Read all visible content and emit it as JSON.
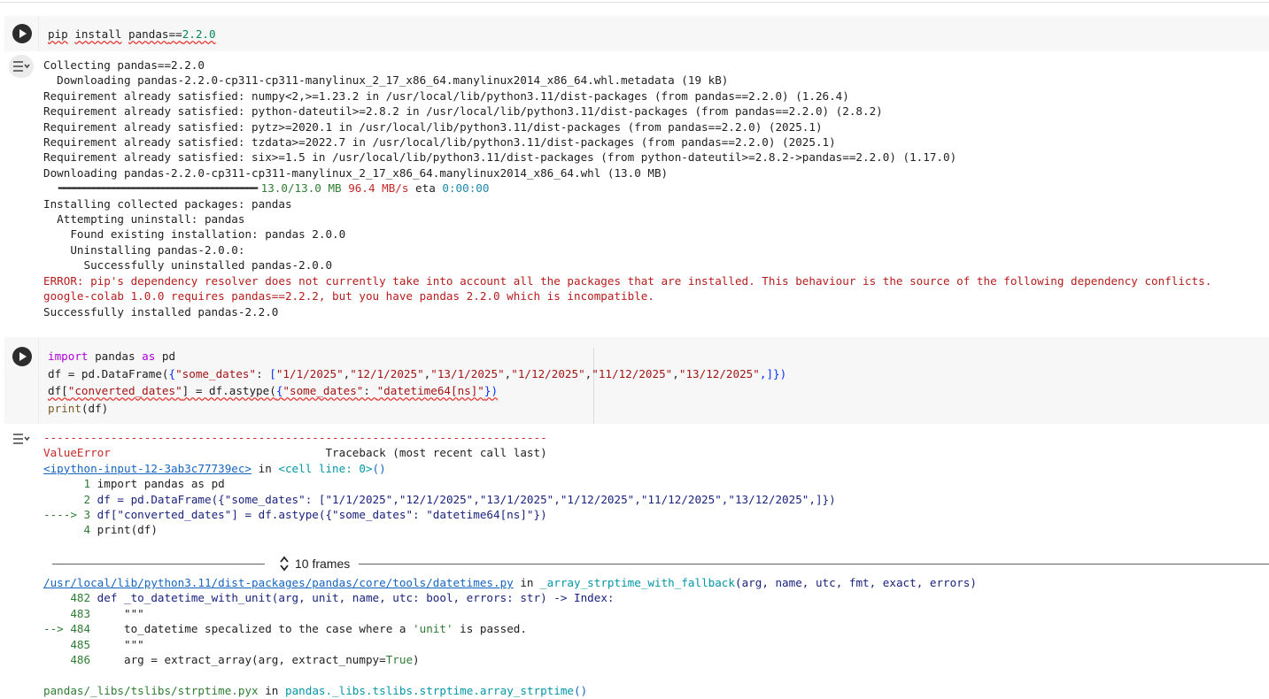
{
  "cell1": {
    "code": {
      "cmd": "pip",
      "install": "install",
      "pkg": "pandas",
      "eq": "==",
      "ver": "2.2.0"
    },
    "output": {
      "l1": "Collecting pandas==2.2.0",
      "l2": "  Downloading pandas-2.2.0-cp311-cp311-manylinux_2_17_x86_64.manylinux2014_x86_64.whl.metadata (19 kB)",
      "l3": "Requirement already satisfied: numpy<2,>=1.23.2 in /usr/local/lib/python3.11/dist-packages (from pandas==2.2.0) (1.26.4)",
      "l4": "Requirement already satisfied: python-dateutil>=2.8.2 in /usr/local/lib/python3.11/dist-packages (from pandas==2.2.0) (2.8.2)",
      "l5": "Requirement already satisfied: pytz>=2020.1 in /usr/local/lib/python3.11/dist-packages (from pandas==2.2.0) (2025.1)",
      "l6": "Requirement already satisfied: tzdata>=2022.7 in /usr/local/lib/python3.11/dist-packages (from pandas==2.2.0) (2025.1)",
      "l7": "Requirement already satisfied: six>=1.5 in /usr/local/lib/python3.11/dist-packages (from python-dateutil>=2.8.2->pandas==2.2.0) (1.17.0)",
      "l8": "Downloading pandas-2.2.0-cp311-cp311-manylinux_2_17_x86_64.manylinux2014_x86_64.whl (13.0 MB)",
      "bar": "   ━━━━━━━━━━━━━━━━━━━━━━━━━━━━━━━━━━━━━━━━ ",
      "size": "13.0/13.0 MB",
      "speed": "96.4 MB/s",
      "eta_label": " eta ",
      "eta": "0:00:00",
      "l10": "Installing collected packages: pandas",
      "l11": "  Attempting uninstall: pandas",
      "l12": "    Found existing installation: pandas 2.0.0",
      "l13": "    Uninstalling pandas-2.0.0:",
      "l14": "      Successfully uninstalled pandas-2.0.0",
      "l15": "ERROR: pip's dependency resolver does not currently take into account all the packages that are installed. This behaviour is the source of the following dependency conflicts.",
      "l16": "google-colab 1.0.0 requires pandas==2.2.2, but you have pandas 2.2.0 which is incompatible.",
      "l17": "Successfully installed pandas-2.2.0"
    }
  },
  "cell2": {
    "code": {
      "l1_import": "import",
      "l1_mid": " pandas ",
      "l1_as": "as",
      "l1_end": " pd",
      "l2_a": "df = pd.DataFrame(",
      "l2_b": "{",
      "l2_key": "\"some_dates\"",
      "l2_c": ": ",
      "l2_d": "[",
      "l2_v1": "\"1/1/2025\"",
      "l2_v2": "\"12/1/2025\"",
      "l2_v3": "\"13/1/2025\"",
      "l2_v4": "\"1/12/2025\"",
      "l2_v5": "\"11/12/2025\"",
      "l2_v6": "\"13/12/2025\"",
      "l2_e": ",]",
      "l2_f": "})",
      "l3_a": "df[",
      "l3_key": "\"converted_dates\"",
      "l3_b": "] = df.astype(",
      "l3_c": "{",
      "l3_key2": "\"some_dates\"",
      "l3_d": ": ",
      "l3_val": "\"datetime64[ns]\"",
      "l3_e": "})",
      "l4_fn": "print",
      "l4_a": "(df)"
    },
    "traceback": {
      "dashes": "---------------------------------------------------------------------------",
      "error_name": "ValueError",
      "tb_header": "                                Traceback (most recent call last)",
      "input_link": "<ipython-input-12-3ab3c77739ec>",
      "in_word": " in ",
      "cell_line": "<cell line: 0>",
      "cell_paren": "()",
      "c1_num": "      1 ",
      "c1_code": "import pandas as pd",
      "c2_num": "      2 ",
      "c2_code": "df = pd.DataFrame({\"some_dates\": [\"1/1/2025\",\"12/1/2025\",\"13/1/2025\",\"1/12/2025\",\"11/12/2025\",\"13/12/2025\",]})",
      "c3_arrow": "----> 3 ",
      "c3_code": "df[\"converted_dates\"] = df.astype({\"some_dates\": \"datetime64[ns]\"})",
      "c4_num": "      4 ",
      "c4_code": "print(df)",
      "frames_label": "10 frames",
      "f1_path": "/usr/local/lib/python3.11/dist-packages/pandas/core/tools/datetimes.py",
      "f1_fn": "_array_strptime_with_fallback",
      "f1_args": "(arg, name, utc, fmt, exact, errors)",
      "f1_l482_num": "    482 ",
      "f1_l482": "def _to_datetime_with_unit(arg, unit, name, utc: bool, errors: str) -> Index:",
      "f1_l483_num": "    483 ",
      "f1_l483": "    \"\"\"",
      "f1_l484_arrow": "--> 484 ",
      "f1_l484_a": "    to_datetime specalized to the case where a ",
      "f1_l484_str": "'unit'",
      "f1_l484_b": " is passed.",
      "f1_l485_num": "    485 ",
      "f1_l485": "    \"\"\"",
      "f1_l486_num": "    486 ",
      "f1_l486_a": "    arg = extract_array(arg, extract_numpy=",
      "f1_l486_true": "True",
      "f1_l486_b": ")",
      "f2_path": "pandas/_libs/tslibs/strptime.pyx",
      "f2_fn": "pandas._libs.tslibs.strptime.array_strptime",
      "f2_paren": "()"
    }
  }
}
